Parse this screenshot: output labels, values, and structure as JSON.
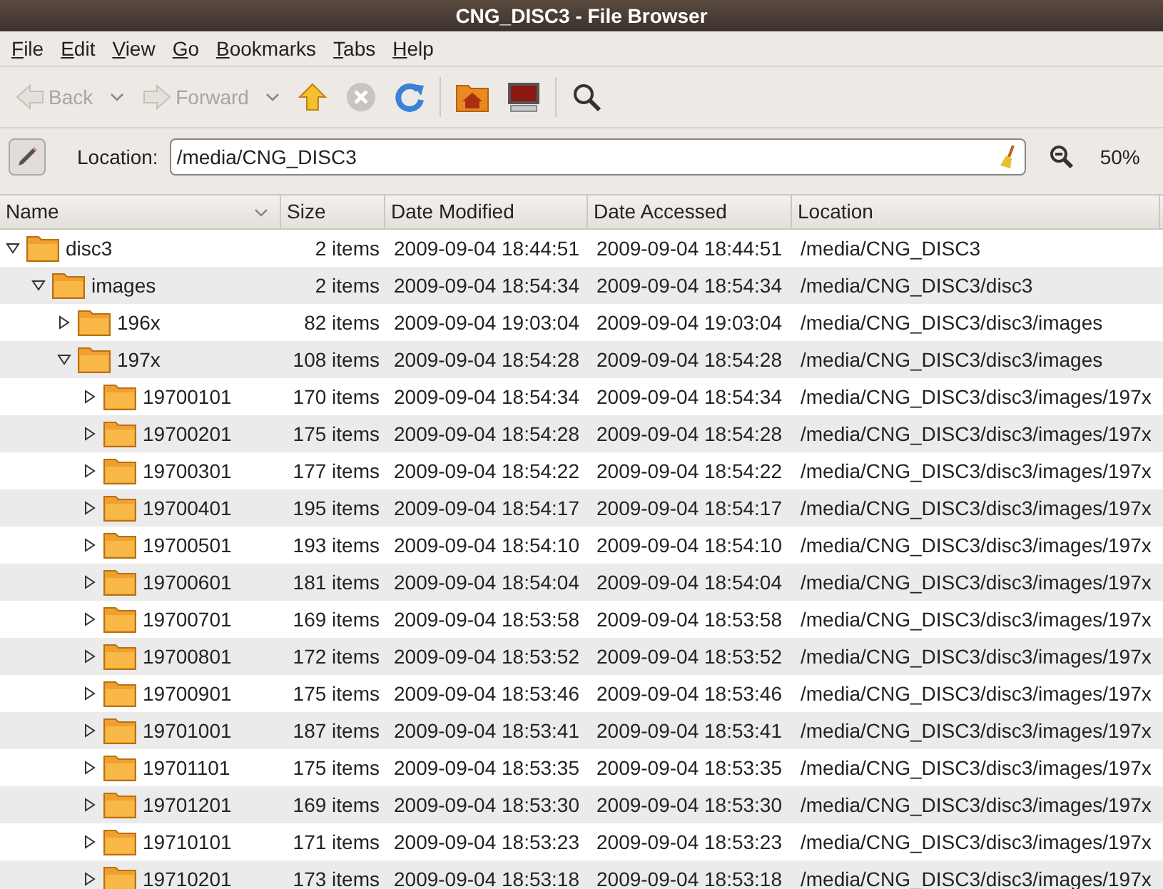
{
  "window": {
    "title": "CNG_DISC3 - File Browser"
  },
  "menu": [
    "File",
    "Edit",
    "View",
    "Go",
    "Bookmarks",
    "Tabs",
    "Help"
  ],
  "toolbar": [
    {
      "kind": "back",
      "label": "Back",
      "disabled": true
    },
    {
      "kind": "forward",
      "label": "Forward",
      "disabled": true
    },
    {
      "kind": "up",
      "disabled": false
    },
    {
      "kind": "stop",
      "disabled": true
    },
    {
      "kind": "reload",
      "disabled": false
    },
    {
      "kind": "home",
      "disabled": false
    },
    {
      "kind": "computer",
      "disabled": false
    },
    {
      "kind": "search",
      "disabled": false
    }
  ],
  "location": {
    "label": "Location:",
    "value": "/media/CNG_DISC3",
    "zoom": "50%"
  },
  "table": {
    "columns": [
      "Name",
      "Size",
      "Date Modified",
      "Date Accessed",
      "Location"
    ],
    "rows": [
      {
        "name": "disc3",
        "size": "2 items",
        "modified": "2009-09-04 18:44:51",
        "accessed": "2009-09-04 18:44:51",
        "location": "/media/CNG_DISC3",
        "expanded": true,
        "children": [
          {
            "name": "images",
            "size": "2 items",
            "modified": "2009-09-04 18:54:34",
            "accessed": "2009-09-04 18:54:34",
            "location": "/media/CNG_DISC3/disc3",
            "expanded": true,
            "children": [
              {
                "name": "196x",
                "size": "82 items",
                "modified": "2009-09-04 19:03:04",
                "accessed": "2009-09-04 19:03:04",
                "location": "/media/CNG_DISC3/disc3/images",
                "expanded": false
              },
              {
                "name": "197x",
                "size": "108 items",
                "modified": "2009-09-04 18:54:28",
                "accessed": "2009-09-04 18:54:28",
                "location": "/media/CNG_DISC3/disc3/images",
                "expanded": true,
                "children": [
                  {
                    "name": "19700101",
                    "size": "170 items",
                    "modified": "2009-09-04 18:54:34",
                    "accessed": "2009-09-04 18:54:34",
                    "location": "/media/CNG_DISC3/disc3/images/197x",
                    "expanded": false
                  },
                  {
                    "name": "19700201",
                    "size": "175 items",
                    "modified": "2009-09-04 18:54:28",
                    "accessed": "2009-09-04 18:54:28",
                    "location": "/media/CNG_DISC3/disc3/images/197x",
                    "expanded": false
                  },
                  {
                    "name": "19700301",
                    "size": "177 items",
                    "modified": "2009-09-04 18:54:22",
                    "accessed": "2009-09-04 18:54:22",
                    "location": "/media/CNG_DISC3/disc3/images/197x",
                    "expanded": false
                  },
                  {
                    "name": "19700401",
                    "size": "195 items",
                    "modified": "2009-09-04 18:54:17",
                    "accessed": "2009-09-04 18:54:17",
                    "location": "/media/CNG_DISC3/disc3/images/197x",
                    "expanded": false
                  },
                  {
                    "name": "19700501",
                    "size": "193 items",
                    "modified": "2009-09-04 18:54:10",
                    "accessed": "2009-09-04 18:54:10",
                    "location": "/media/CNG_DISC3/disc3/images/197x",
                    "expanded": false
                  },
                  {
                    "name": "19700601",
                    "size": "181 items",
                    "modified": "2009-09-04 18:54:04",
                    "accessed": "2009-09-04 18:54:04",
                    "location": "/media/CNG_DISC3/disc3/images/197x",
                    "expanded": false
                  },
                  {
                    "name": "19700701",
                    "size": "169 items",
                    "modified": "2009-09-04 18:53:58",
                    "accessed": "2009-09-04 18:53:58",
                    "location": "/media/CNG_DISC3/disc3/images/197x",
                    "expanded": false
                  },
                  {
                    "name": "19700801",
                    "size": "172 items",
                    "modified": "2009-09-04 18:53:52",
                    "accessed": "2009-09-04 18:53:52",
                    "location": "/media/CNG_DISC3/disc3/images/197x",
                    "expanded": false
                  },
                  {
                    "name": "19700901",
                    "size": "175 items",
                    "modified": "2009-09-04 18:53:46",
                    "accessed": "2009-09-04 18:53:46",
                    "location": "/media/CNG_DISC3/disc3/images/197x",
                    "expanded": false
                  },
                  {
                    "name": "19701001",
                    "size": "187 items",
                    "modified": "2009-09-04 18:53:41",
                    "accessed": "2009-09-04 18:53:41",
                    "location": "/media/CNG_DISC3/disc3/images/197x",
                    "expanded": false
                  },
                  {
                    "name": "19701101",
                    "size": "175 items",
                    "modified": "2009-09-04 18:53:35",
                    "accessed": "2009-09-04 18:53:35",
                    "location": "/media/CNG_DISC3/disc3/images/197x",
                    "expanded": false
                  },
                  {
                    "name": "19701201",
                    "size": "169 items",
                    "modified": "2009-09-04 18:53:30",
                    "accessed": "2009-09-04 18:53:30",
                    "location": "/media/CNG_DISC3/disc3/images/197x",
                    "expanded": false
                  },
                  {
                    "name": "19710101",
                    "size": "171 items",
                    "modified": "2009-09-04 18:53:23",
                    "accessed": "2009-09-04 18:53:23",
                    "location": "/media/CNG_DISC3/disc3/images/197x",
                    "expanded": false
                  },
                  {
                    "name": "19710201",
                    "size": "173 items",
                    "modified": "2009-09-04 18:53:18",
                    "accessed": "2009-09-04 18:53:18",
                    "location": "/media/CNG_DISC3/disc3/images/197x",
                    "expanded": false
                  }
                ]
              }
            ]
          }
        ]
      }
    ]
  }
}
